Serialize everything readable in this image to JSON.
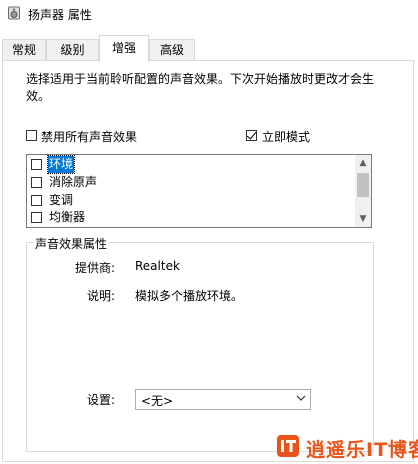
{
  "window": {
    "title": "扬声器 属性",
    "icon": "speaker-icon"
  },
  "tabs": [
    {
      "label": "常规",
      "active": false
    },
    {
      "label": "级别",
      "active": false
    },
    {
      "label": "增强",
      "active": true
    },
    {
      "label": "高级",
      "active": false
    }
  ],
  "enhancements": {
    "description": "选择适用于当前聆听配置的声音效果。下次开始播放时更改才会生效。",
    "disable_all": {
      "label": "禁用所有声音效果",
      "checked": false
    },
    "immediate_mode": {
      "label": "立即模式",
      "checked": true
    },
    "effects": [
      {
        "label": "环境",
        "checked": false,
        "selected": true
      },
      {
        "label": "消除原声",
        "checked": false,
        "selected": false
      },
      {
        "label": "变调",
        "checked": false,
        "selected": false
      },
      {
        "label": "均衡器",
        "checked": false,
        "selected": false
      }
    ]
  },
  "properties": {
    "group_title": "声音效果属性",
    "provider_label": "提供商:",
    "provider_value": "Realtek",
    "description_label": "说明:",
    "description_value": "模拟多个播放环境。",
    "setting_label": "设置:",
    "setting_value": "<无>"
  },
  "watermark": {
    "text": "逍遥乐IT博客",
    "color": "#e8541a"
  }
}
